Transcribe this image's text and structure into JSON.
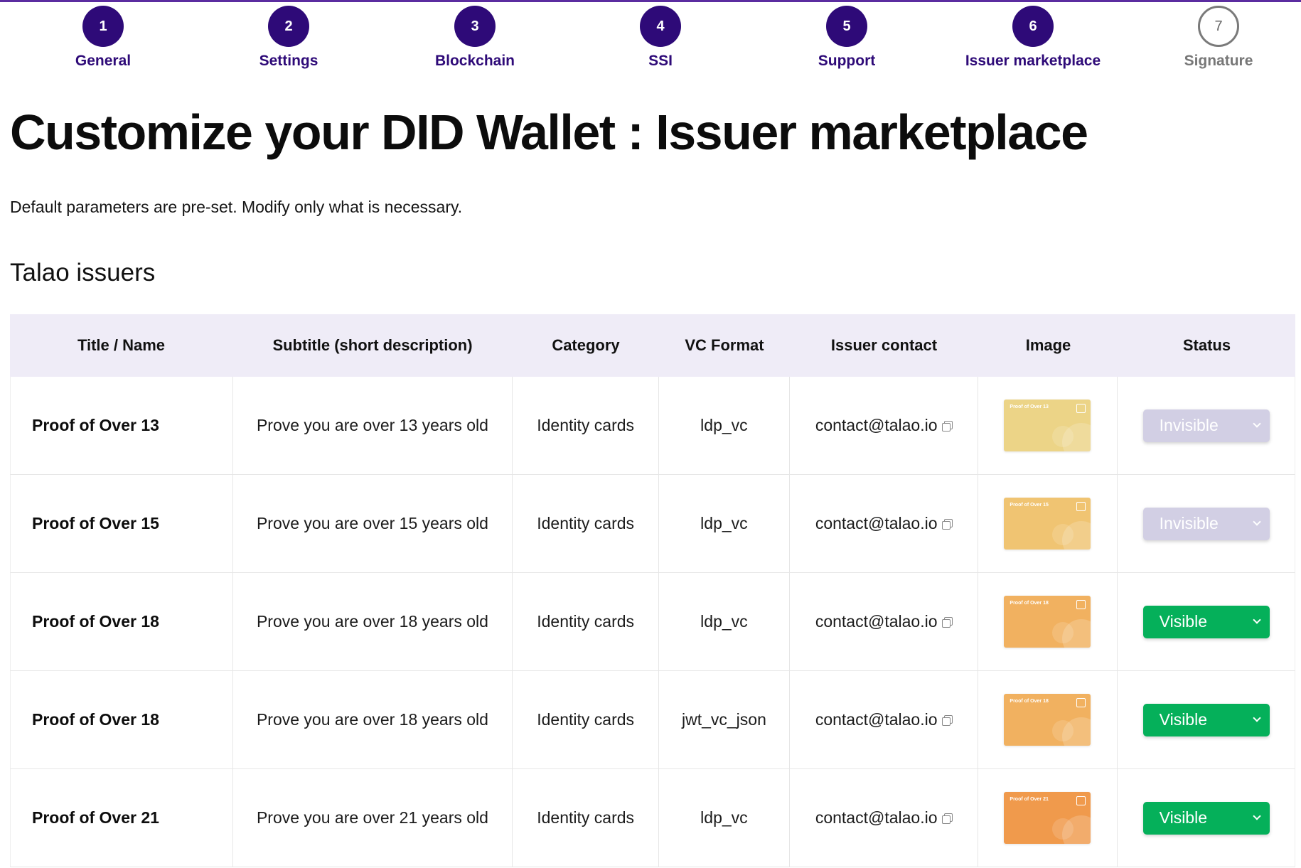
{
  "stepper": [
    {
      "number": "1",
      "label": "General",
      "state": "done"
    },
    {
      "number": "2",
      "label": "Settings",
      "state": "done"
    },
    {
      "number": "3",
      "label": "Blockchain",
      "state": "done"
    },
    {
      "number": "4",
      "label": "SSI",
      "state": "done"
    },
    {
      "number": "5",
      "label": "Support",
      "state": "done"
    },
    {
      "number": "6",
      "label": "Issuer marketplace",
      "state": "done"
    },
    {
      "number": "7",
      "label": "Signature",
      "state": "pending"
    }
  ],
  "page": {
    "title": "Customize your DID Wallet : Issuer marketplace",
    "intro": "Default parameters are pre-set. Modify only what is necessary.",
    "section_title": "Talao issuers"
  },
  "table": {
    "headers": [
      "Title / Name",
      "Subtitle (short description)",
      "Category",
      "VC Format",
      "Issuer contact",
      "Image",
      "Status"
    ],
    "rows": [
      {
        "title": "Proof of Over 13",
        "subtitle": "Prove you are over 13 years old",
        "category": "Identity cards",
        "format": "ldp_vc",
        "contact": "contact@talao.io",
        "image_label": "Proof of Over 13",
        "image_color": "#ecd487",
        "status": "Invisible"
      },
      {
        "title": "Proof of Over 15",
        "subtitle": "Prove you are over 15 years old",
        "category": "Identity cards",
        "format": "ldp_vc",
        "contact": "contact@talao.io",
        "image_label": "Proof of Over 15",
        "image_color": "#f0c472",
        "status": "Invisible"
      },
      {
        "title": "Proof of Over 18",
        "subtitle": "Prove you are over 18 years old",
        "category": "Identity cards",
        "format": "ldp_vc",
        "contact": "contact@talao.io",
        "image_label": "Proof of Over 18",
        "image_color": "#f1b160",
        "status": "Visible"
      },
      {
        "title": "Proof of Over 18",
        "subtitle": "Prove you are over 18 years old",
        "category": "Identity cards",
        "format": "jwt_vc_json",
        "contact": "contact@talao.io",
        "image_label": "Proof of Over 18",
        "image_color": "#f1b160",
        "status": "Visible"
      },
      {
        "title": "Proof of Over 21",
        "subtitle": "Prove you are over 21 years old",
        "category": "Identity cards",
        "format": "ldp_vc",
        "contact": "contact@talao.io",
        "image_label": "Proof of Over 21",
        "image_color": "#f09a4c",
        "status": "Visible"
      }
    ]
  },
  "colors": {
    "accent": "#2e0a78",
    "visible": "#05b05a",
    "invisible": "#d2cfe4",
    "header_bg": "#efecf7"
  }
}
